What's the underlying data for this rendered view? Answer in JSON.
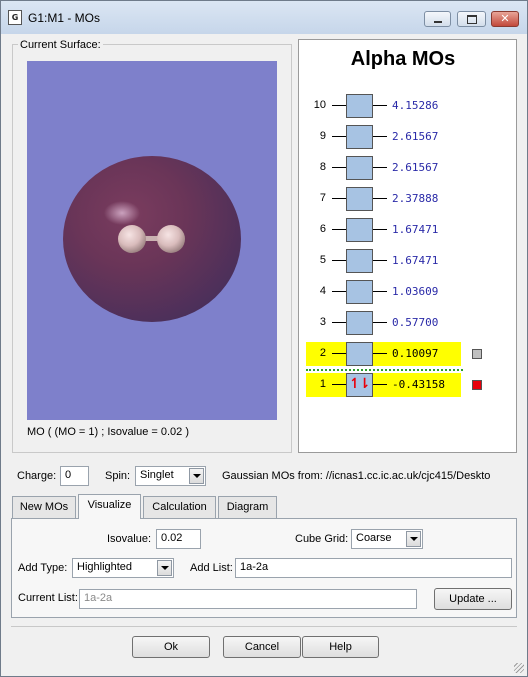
{
  "window": {
    "title": "G1:M1 - MOs"
  },
  "surface": {
    "label": "Current Surface:",
    "caption": "MO ( (MO = 1) ; Isovalue = 0.02 )"
  },
  "mo_panel": {
    "title": "Alpha MOs",
    "orbitals": [
      {
        "num": "10",
        "energy": "4.15286"
      },
      {
        "num": "9",
        "energy": "2.61567"
      },
      {
        "num": "8",
        "energy": "2.61567"
      },
      {
        "num": "7",
        "energy": "2.37888"
      },
      {
        "num": "6",
        "energy": "1.67471"
      },
      {
        "num": "5",
        "energy": "1.67471"
      },
      {
        "num": "4",
        "energy": "1.03609"
      },
      {
        "num": "3",
        "energy": "0.57700"
      },
      {
        "num": "2",
        "energy": "0.10097",
        "highlighted": true,
        "swatch": "#c0c0c0"
      },
      {
        "num": "1",
        "energy": "-0.43158",
        "highlighted": true,
        "occupied": true,
        "swatch": "#e8000b"
      }
    ],
    "electron_glyphs": "↿⇂"
  },
  "params": {
    "charge_label": "Charge:",
    "charge_value": "0",
    "spin_label": "Spin:",
    "spin_value": "Singlet",
    "source_text": "Gaussian MOs from:  //icnas1.cc.ic.ac.uk/cjc415/Deskto"
  },
  "tabs": [
    "New MOs",
    "Visualize",
    "Calculation",
    "Diagram"
  ],
  "active_tab": "Visualize",
  "visualize": {
    "isovalue_label": "Isovalue:",
    "isovalue": "0.02",
    "cube_grid_label": "Cube Grid:",
    "cube_grid": "Coarse",
    "add_type_label": "Add Type:",
    "add_type": "Highlighted",
    "add_list_label": "Add List:",
    "add_list": "1a-2a",
    "current_list_label": "Current List:",
    "current_list": "1a-2a",
    "update_button": "Update ..."
  },
  "footer": {
    "ok": "Ok",
    "cancel": "Cancel",
    "help": "Help"
  },
  "colors": {
    "viewport_bg": "#7e80cb",
    "mo_box": "#a7c3e3",
    "highlight": "#ffff00",
    "energy_text": "#2a2aa8"
  }
}
